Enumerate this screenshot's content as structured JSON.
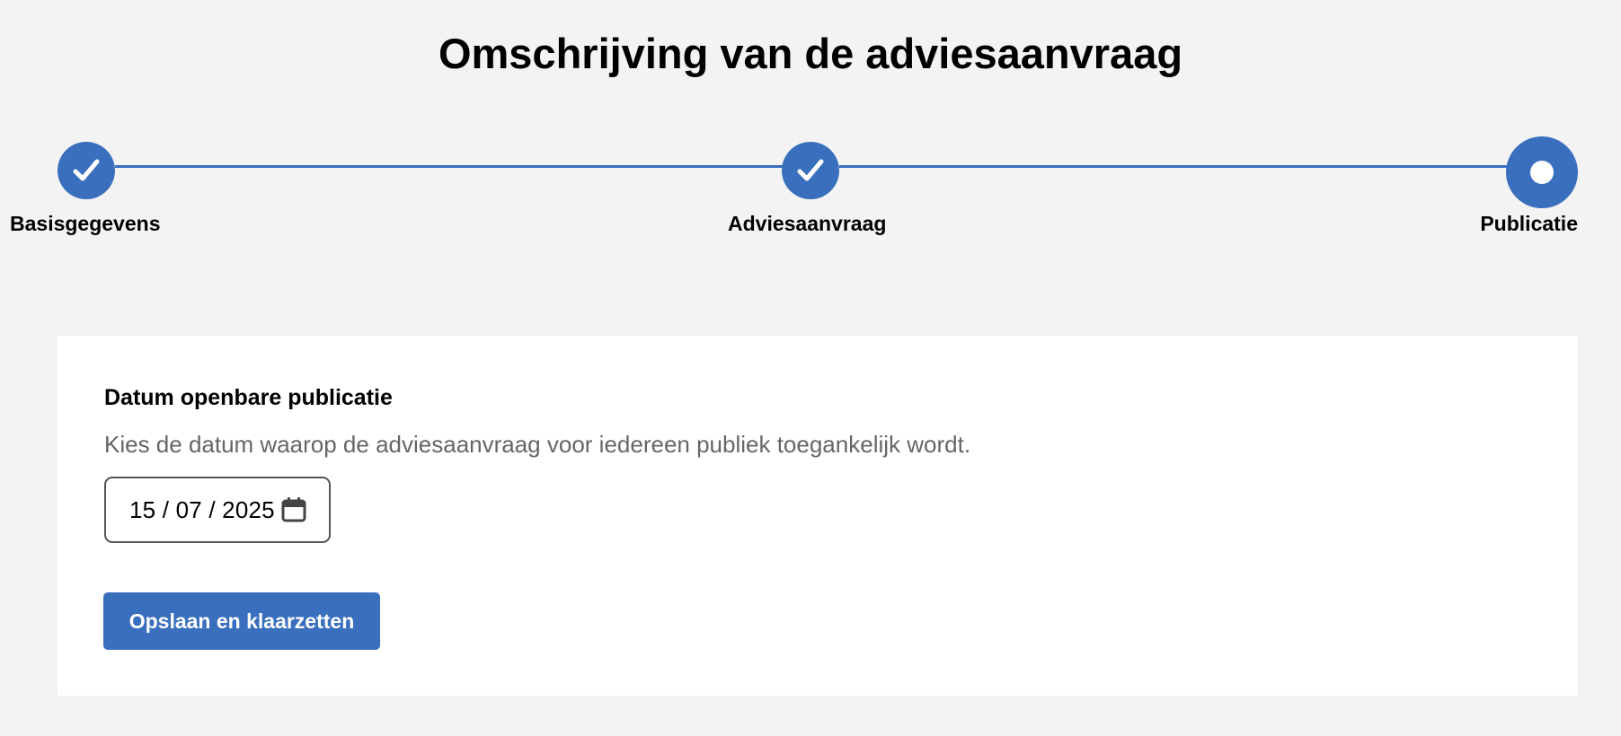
{
  "page": {
    "title": "Omschrijving van de adviesaanvraag"
  },
  "stepper": {
    "accent_color": "#3a6fbe",
    "steps": [
      {
        "label": "Basisgegevens",
        "status": "completed",
        "icon": "check-icon"
      },
      {
        "label": "Adviesaanvraag",
        "status": "completed",
        "icon": "check-icon"
      },
      {
        "label": "Publicatie",
        "status": "current",
        "icon": "current-dot-icon"
      }
    ]
  },
  "form": {
    "field_label": "Datum openbare publicatie",
    "field_hint": "Kies de datum waarop de adviesaanvraag voor iedereen publiek toegankelijk wordt.",
    "date_value": "15 / 07 / 2025",
    "date_icon": "calendar-icon",
    "submit_label": "Opslaan en klaarzetten"
  }
}
